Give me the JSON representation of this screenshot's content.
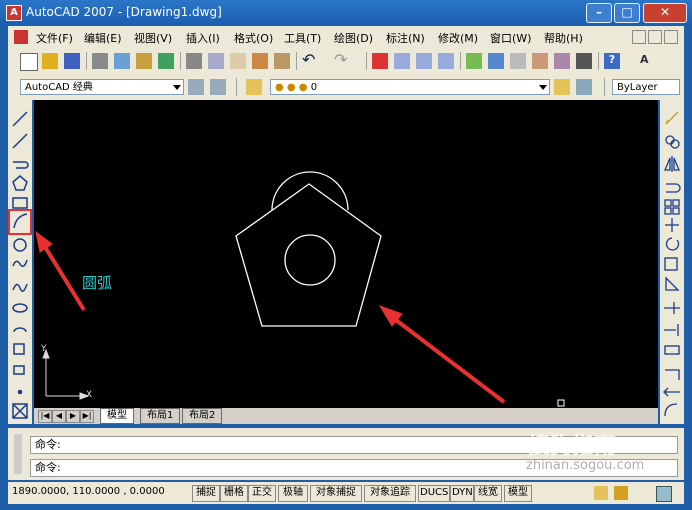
{
  "window": {
    "title": "AutoCAD 2007 - [Drawing1.dwg]",
    "minimize": "–",
    "maximize": "□",
    "close": "✕"
  },
  "menu": [
    "文件(F)",
    "编辑(E)",
    "视图(V)",
    "插入(I)",
    "格式(O)",
    "工具(T)",
    "绘图(D)",
    "标注(N)",
    "修改(M)",
    "窗口(W)",
    "帮助(H)"
  ],
  "workspace": {
    "value": "AutoCAD 经典"
  },
  "layer": {
    "value": "0"
  },
  "linetype": {
    "value": "ByLayer"
  },
  "canvas": {
    "annotation": "圆弧",
    "ucs_y": "Y",
    "ucs_x": "X"
  },
  "tabs": [
    "模型",
    "布局1",
    "布局2"
  ],
  "command": {
    "line1": "命令:",
    "line2": "命令:"
  },
  "watermark": {
    "text": "搜狗指南",
    "url": "zhinan.sogou.com"
  },
  "status": {
    "coords": "1890.0000, 110.0000 , 0.0000",
    "buttons": [
      "捕捉",
      "栅格",
      "正交",
      "极轴",
      "对象捕捉",
      "对象追踪",
      "DUCS",
      "DYN",
      "线宽",
      "模型"
    ]
  },
  "colors": {
    "accent": "#e83030",
    "annotation_text": "#2fc7c7",
    "titlebar": "#1b5fb0"
  }
}
